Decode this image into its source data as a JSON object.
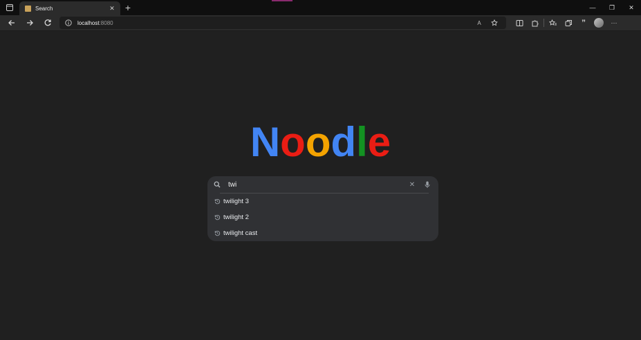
{
  "browser": {
    "tab": {
      "title": "Search"
    },
    "address": {
      "host": "localhost",
      "port": ":8080"
    }
  },
  "page": {
    "logo": [
      {
        "ch": "N",
        "color": "#4285f4"
      },
      {
        "ch": "o",
        "color": "#ea1d14"
      },
      {
        "ch": "o",
        "color": "#f4a300"
      },
      {
        "ch": "d",
        "color": "#4285f4"
      },
      {
        "ch": "l",
        "color": "#139222"
      },
      {
        "ch": "e",
        "color": "#ea1d14"
      }
    ],
    "search": {
      "query": "twi",
      "suggestions": [
        "twilight 3",
        "twilight 2",
        "twilight cast"
      ]
    }
  },
  "icons": {
    "tab_close": "✕",
    "new_tab": "+",
    "minimize": "—",
    "restore": "❐",
    "close": "✕",
    "read_aloud": "A",
    "more": "···",
    "clear": "✕"
  }
}
